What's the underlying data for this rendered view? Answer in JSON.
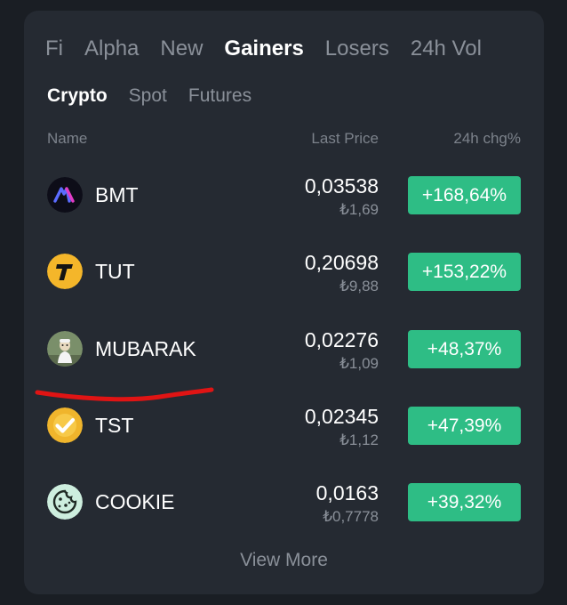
{
  "tabs": [
    {
      "label": "Fi",
      "active": false
    },
    {
      "label": "Alpha",
      "active": false
    },
    {
      "label": "New",
      "active": false
    },
    {
      "label": "Gainers",
      "active": true
    },
    {
      "label": "Losers",
      "active": false
    },
    {
      "label": "24h Vol",
      "active": false
    }
  ],
  "subtabs": [
    {
      "label": "Crypto",
      "active": true
    },
    {
      "label": "Spot",
      "active": false
    },
    {
      "label": "Futures",
      "active": false
    }
  ],
  "headers": {
    "name": "Name",
    "price": "Last Price",
    "change": "24h chg%"
  },
  "rows": [
    {
      "name": "BMT",
      "price": "0,03538",
      "fiat": "₺1,69",
      "change": "+168,64%",
      "icon": "bmt-logo-icon"
    },
    {
      "name": "TUT",
      "price": "0,20698",
      "fiat": "₺9,88",
      "change": "+153,22%",
      "icon": "tut-logo-icon"
    },
    {
      "name": "MUBARAK",
      "price": "0,02276",
      "fiat": "₺1,09",
      "change": "+48,37%",
      "icon": "mubarak-logo-icon"
    },
    {
      "name": "TST",
      "price": "0,02345",
      "fiat": "₺1,12",
      "change": "+47,39%",
      "icon": "tst-logo-icon"
    },
    {
      "name": "COOKIE",
      "price": "0,0163",
      "fiat": "₺0,7778",
      "change": "+39,32%",
      "icon": "cookie-logo-icon"
    }
  ],
  "view_more": "View More",
  "colors": {
    "background": "#1a1e24",
    "card": "#252a32",
    "positive": "#2ebd85",
    "muted_text": "#8a9099",
    "annotation": "#e01414"
  }
}
